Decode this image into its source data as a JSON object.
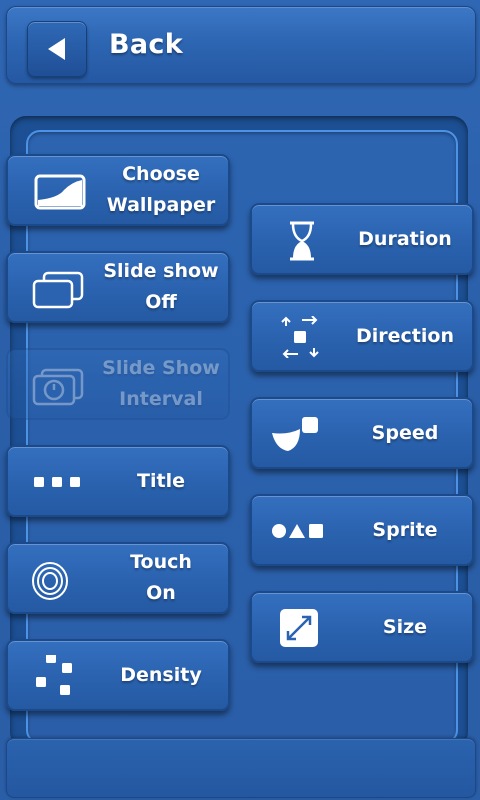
{
  "header": {
    "back_label": "Back"
  },
  "left_tiles": [
    {
      "line1": "Choose",
      "line2": "Wallpaper",
      "icon": "wallpaper-icon"
    },
    {
      "line1": "Slide show",
      "line2": "Off",
      "icon": "slideshow-icon"
    },
    {
      "line1": "Slide Show",
      "line2": "Interval",
      "icon": "timer-icon",
      "disabled": true
    },
    {
      "line1": "Title",
      "line2": "",
      "icon": "dots-icon"
    },
    {
      "line1": "Touch",
      "line2": "On",
      "icon": "touch-icon"
    },
    {
      "line1": "Density",
      "line2": "",
      "icon": "density-icon"
    }
  ],
  "right_tiles": [
    {
      "label": "Duration",
      "icon": "hourglass-icon"
    },
    {
      "label": "Direction",
      "icon": "direction-arrows-icon"
    },
    {
      "label": "Speed",
      "icon": "speed-icon"
    },
    {
      "label": "Sprite",
      "icon": "shapes-icon"
    },
    {
      "label": "Size",
      "icon": "resize-icon"
    }
  ],
  "colors": {
    "background": "#2a5ea7",
    "tile": "#2b63b0",
    "accent_border": "#4c92e6"
  }
}
